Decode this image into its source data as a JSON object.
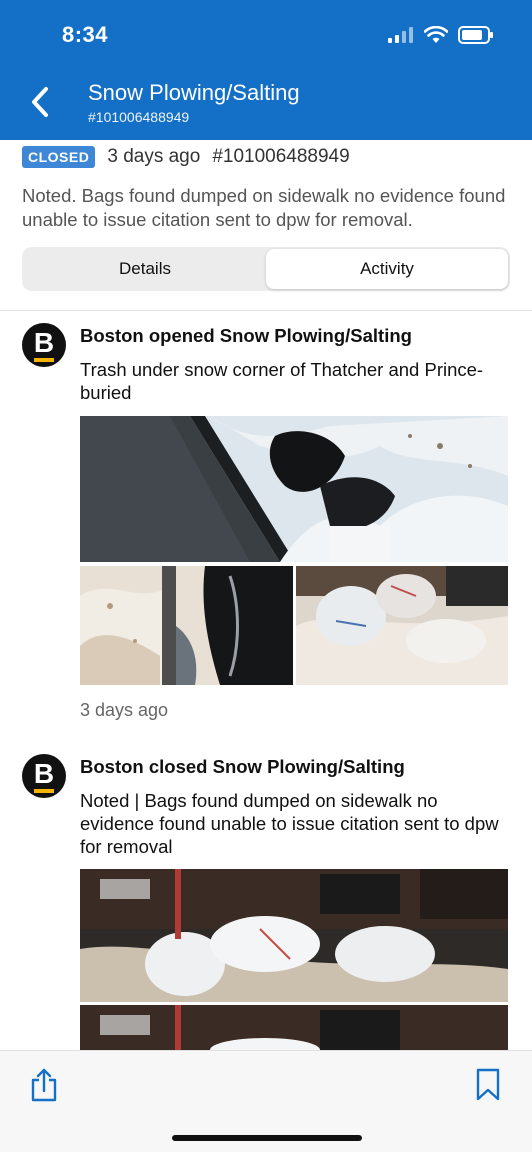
{
  "status_bar": {
    "time": "8:34"
  },
  "header": {
    "back_icon": "chevron-left-icon",
    "title": "Snow Plowing/Salting",
    "subtitle": "#101006488949"
  },
  "request": {
    "status": "CLOSED",
    "age": "3 days ago",
    "number": "#101006488949",
    "note": "Noted. Bags found dumped on sidewalk no evidence found unable to issue citation sent to dpw for removal."
  },
  "tabs": [
    {
      "label": "Details",
      "active": false
    },
    {
      "label": "Activity",
      "active": true
    }
  ],
  "activity": [
    {
      "avatar_letter": "B",
      "title": "Boston opened Snow Plowing/Salting",
      "description": "Trash under snow corner of Thatcher and Prince-buried",
      "time": "3 days ago"
    },
    {
      "avatar_letter": "B",
      "title": "Boston closed Snow Plowing/Salting",
      "description": "Noted | Bags found dumped on sidewalk no evidence found unable to issue citation sent to dpw for removal"
    }
  ],
  "bottom_bar": {
    "share_icon": "share-icon",
    "bookmark_icon": "bookmark-icon"
  },
  "colors": {
    "header": "#1470c6",
    "badge": "#3d87d6",
    "avatar_bar": "#f5b400"
  }
}
